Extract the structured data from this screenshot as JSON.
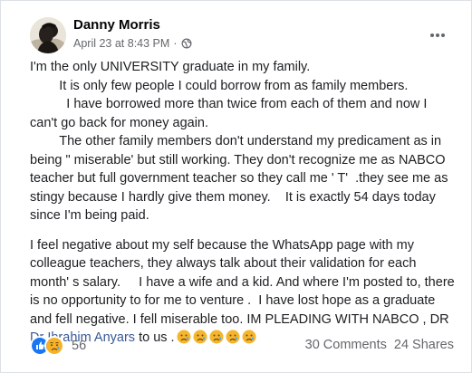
{
  "post": {
    "author": "Danny Morris",
    "date": "April 23 at 8:43 PM",
    "separator": "·",
    "paragraphs": [
      "I'm the only UNIVERSITY graduate in my family.",
      "        It is only few people I could borrow from as family members.",
      "          I have borrowed more than twice from each of them and now I can't go back for money again.",
      "        The other family members don't understand my predicament as in being \" miserable' but still working. They don't recognize me as NABCO teacher but full government teacher so they call me ' T'  .they see me as stingy because I hardly give them money.    It is exactly 54 days today since I'm being paid."
    ],
    "paragraph2": "I feel negative about my self because the WhatsApp page with my colleague teachers, they always talk about their validation for each month' s salary.     I have a wife and a kid. And where I'm posted to, there is no opportunity to for me to venture .  I have lost hope as a graduate and fell negative. I fell miserable too. IM PLEADING WITH NABCO , DR ",
    "mention": "Dr Ibrahim Anyars",
    "ending": " to us .",
    "emoji_count": 5
  },
  "footer": {
    "reaction_count": "56",
    "comments": "30 Comments",
    "shares": "24 Shares"
  },
  "icons": {
    "globe": "globe-icon",
    "more": "more-options-icon",
    "like": "like-reaction-icon",
    "sad": "sad-reaction-icon",
    "emoji": "sad-face-emoji"
  },
  "colors": {
    "like": "#1877f2",
    "sad": "#f7b125",
    "meta": "#65676b",
    "mention": "#385898"
  }
}
